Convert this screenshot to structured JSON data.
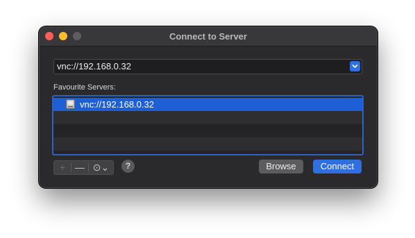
{
  "window": {
    "title": "Connect to Server"
  },
  "address": {
    "value": "vnc://192.168.0.32"
  },
  "favourites": {
    "label": "Favourite Servers:",
    "items": [
      {
        "label": "vnc://192.168.0.32",
        "selected": true
      }
    ]
  },
  "toolbar": {
    "add_label": "+",
    "remove_label": "—",
    "action_label": "⊙⌄",
    "help_label": "?"
  },
  "buttons": {
    "browse_label": "Browse",
    "connect_label": "Connect"
  },
  "colors": {
    "accent": "#2f6fe0",
    "selection": "#1f5fd6",
    "window_bg": "#2a2a2c"
  }
}
